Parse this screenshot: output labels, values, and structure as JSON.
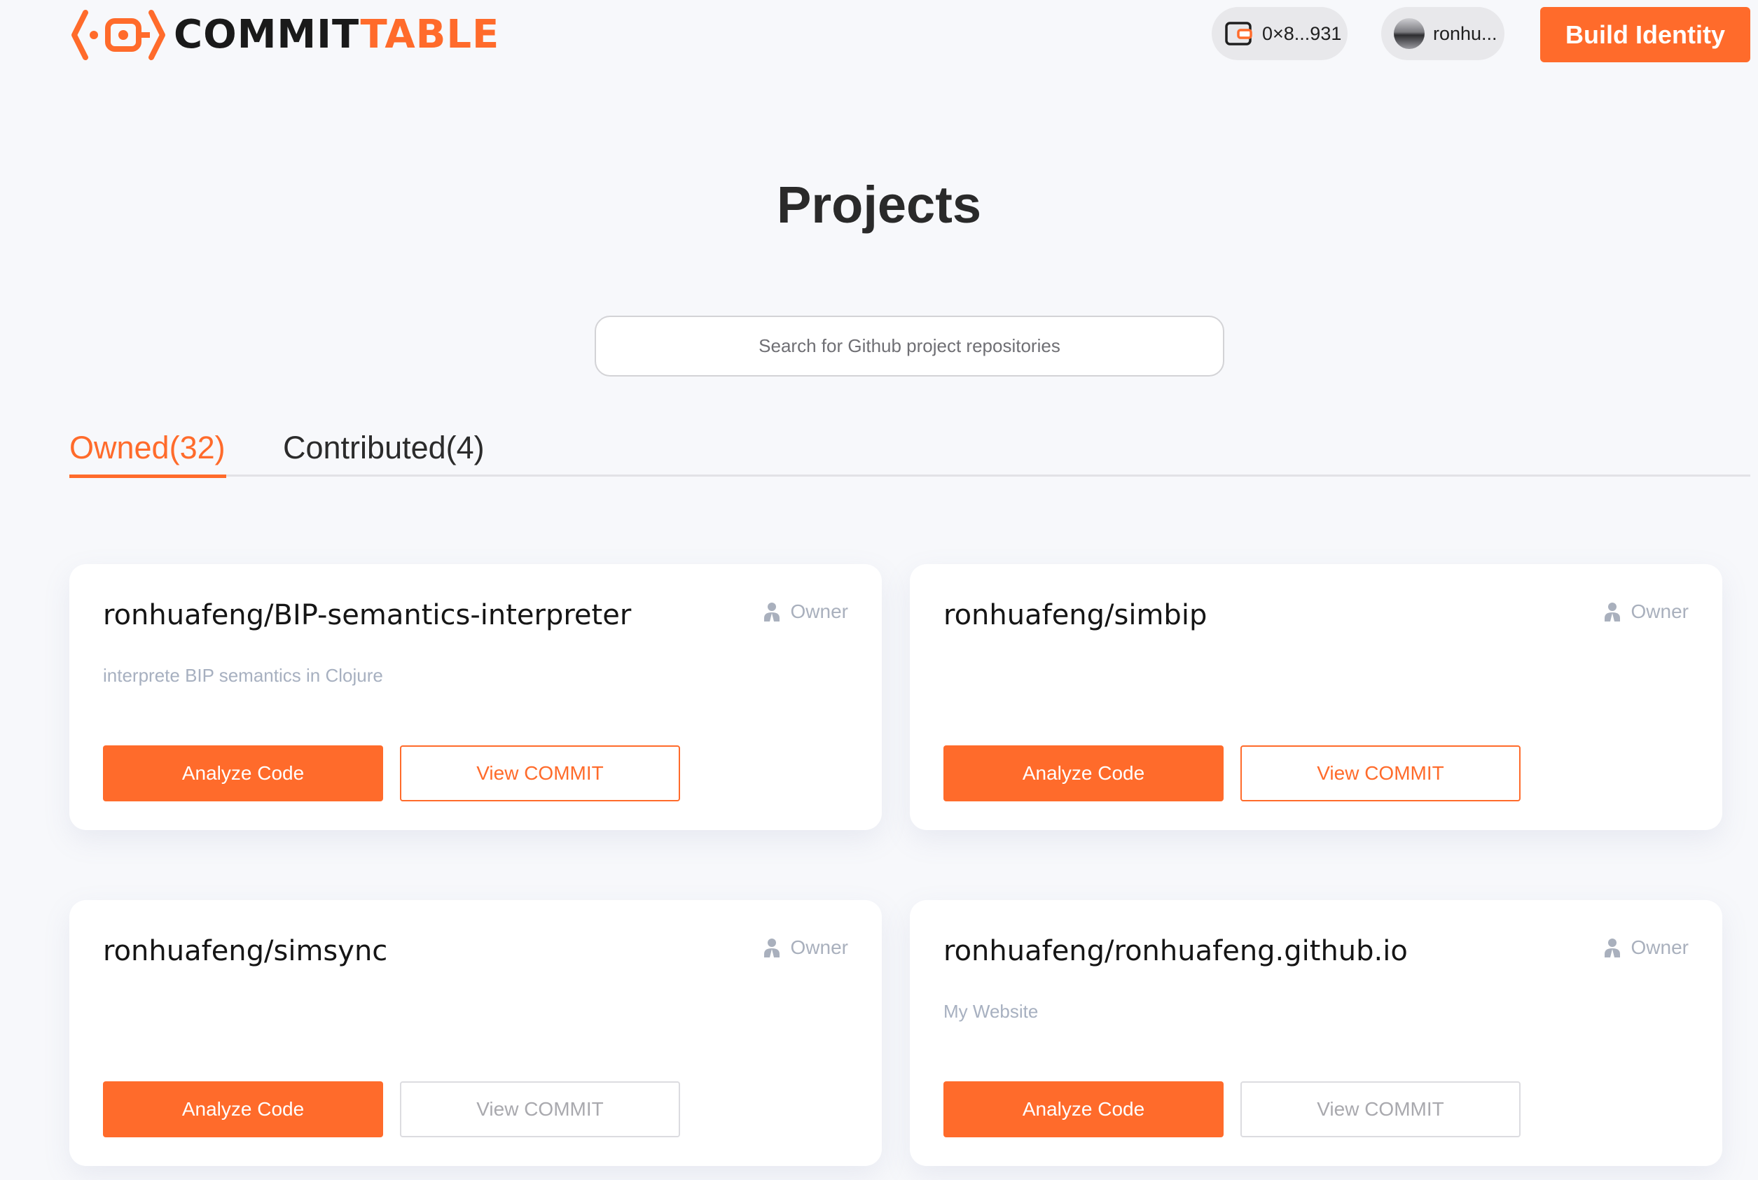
{
  "app": {
    "logo_icon": "code-key-logo-icon",
    "logo_text_main": "COMMIT",
    "logo_text_accent": "TABLE",
    "brand_color": "#ff6b2b"
  },
  "header": {
    "wallet_icon": "wallet-icon",
    "wallet_address": "0×8...931",
    "username": "ronhu...",
    "build_button_label": "Build Identity"
  },
  "page": {
    "title": "Projects"
  },
  "search": {
    "placeholder": "Search for Github project repositories"
  },
  "tabs": [
    {
      "label": "Owned(32)",
      "active": true
    },
    {
      "label": "Contributed(4)",
      "active": false
    }
  ],
  "cards": [
    {
      "title": "ronhuafeng/BIP-semantics-interpreter",
      "role": "Owner",
      "description": "interprete BIP semantics in Clojure",
      "analyze_label": "Analyze Code",
      "view_label": "View COMMIT",
      "view_enabled": true
    },
    {
      "title": "ronhuafeng/simbip",
      "role": "Owner",
      "description": "",
      "analyze_label": "Analyze Code",
      "view_label": "View COMMIT",
      "view_enabled": true
    },
    {
      "title": "ronhuafeng/simsync",
      "role": "Owner",
      "description": "",
      "analyze_label": "Analyze Code",
      "view_label": "View COMMIT",
      "view_enabled": false
    },
    {
      "title": "ronhuafeng/ronhuafeng.github.io",
      "role": "Owner",
      "description": "My Website",
      "analyze_label": "Analyze Code",
      "view_label": "View COMMIT",
      "view_enabled": false
    }
  ]
}
